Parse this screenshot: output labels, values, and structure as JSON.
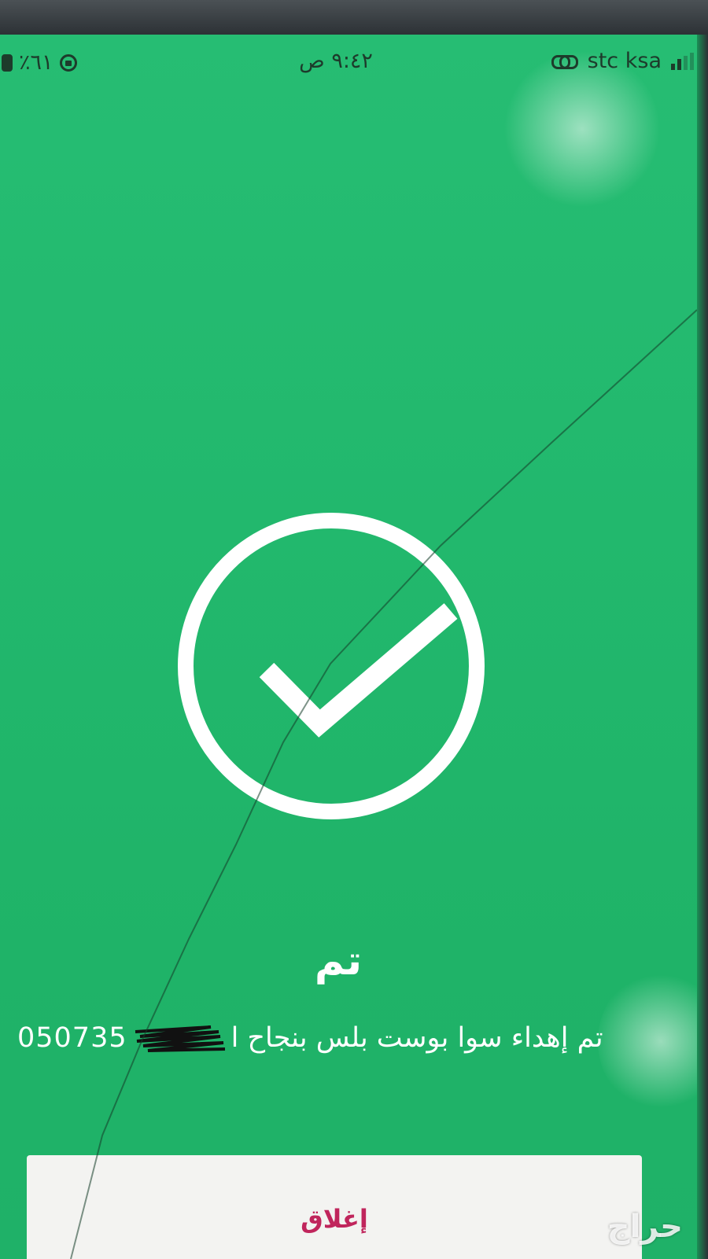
{
  "status_bar": {
    "battery_percent": "٪٦١",
    "time": "٩:٤٢ ص",
    "carrier": "stc ksa"
  },
  "main": {
    "title": "تم",
    "message": "تم إهداء سوا بوست بلس بنجاح ا",
    "phone_number_visible": "050735"
  },
  "footer": {
    "close_label": "إغلاق"
  },
  "watermark": "حراج",
  "colors": {
    "background": "#22b86d",
    "check_circle": "#ffffff",
    "close_text": "#c0255c",
    "button_bg": "#f3f3f1"
  }
}
